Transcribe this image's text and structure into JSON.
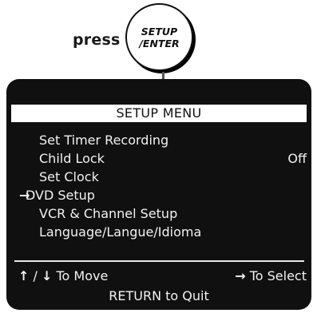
{
  "instruction": {
    "press_label": "press",
    "button_line1": "SETUP",
    "button_line2": "/ENTER"
  },
  "menu": {
    "title": "SETUP MENU",
    "items": [
      {
        "label": "Set Timer Recording",
        "value": "",
        "selected": false
      },
      {
        "label": "Child Lock",
        "value": "Off",
        "selected": false
      },
      {
        "label": "Set Clock",
        "value": "",
        "selected": false
      },
      {
        "label": "DVD Setup",
        "value": "",
        "selected": true
      },
      {
        "label": "VCR & Channel Setup",
        "value": "",
        "selected": false
      },
      {
        "label": "Language/Langue/Idioma",
        "value": "",
        "selected": false
      }
    ],
    "cursor_icon": "right-arrow-icon"
  },
  "footer": {
    "up_arrow": "↑",
    "slash": " / ",
    "down_arrow": "↓",
    "move_text": " To Move",
    "select_arrow": "→",
    "select_text": " To Select",
    "quit_text": "RETURN to Quit"
  },
  "colors": {
    "screen_bg": "#101010",
    "screen_text": "#f2f2f2",
    "title_bar_bg": "#ffffff"
  }
}
